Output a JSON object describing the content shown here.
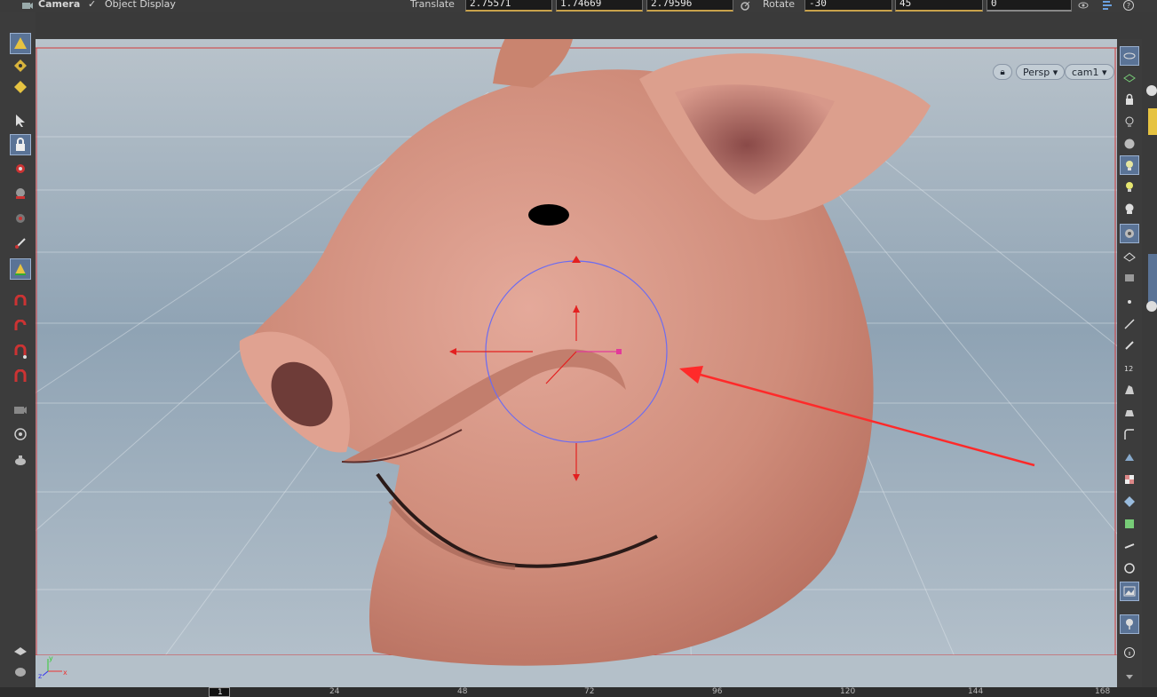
{
  "topbar": {
    "camera_label": "Camera",
    "object_display_label": "Object Display",
    "translate_label": "Translate",
    "translate_x": "2.75571",
    "translate_y": "1.74669",
    "translate_z": "2.79596",
    "rotate_label": "Rotate",
    "rotate_x": "-30",
    "rotate_y": "45",
    "rotate_z": "0"
  },
  "viewport": {
    "view_menu": "Persp",
    "camera_menu": "cam1",
    "axis_labels": {
      "x": "x",
      "y": "y",
      "z": "z"
    }
  },
  "timeline": {
    "current_frame": "1",
    "ticks": [
      "24",
      "48",
      "72",
      "96",
      "120",
      "144",
      "168"
    ]
  },
  "colors": {
    "accent_blue": "#5a7396",
    "handle_red": "#e32020",
    "annotation_arrow": "#ff2a2a",
    "ring": "#6d6cf0"
  },
  "icons": {
    "left_toolbar": [
      "pyramid-select-icon",
      "point-select-icon",
      "face-select-icon",
      "arrow-select-icon",
      "lock-icon",
      "pose-icon",
      "render-handle-icon",
      "light-handle-icon",
      "bone-icon",
      "translate-handle-icon",
      "magnet-move-icon",
      "magnet-curve-icon",
      "magnet-point-icon",
      "magnet-icon",
      "camera-icon",
      "camera-lens-icon",
      "teapot-icon",
      "display-icon",
      "shading-icon"
    ],
    "right_toolbar": [
      "view-options-icon",
      "layers-icon",
      "lock-icon",
      "light-bulb-icon",
      "sphere-icon",
      "headlight-icon",
      "light-icon",
      "skull-icon",
      "textured-view-icon",
      "wire-icon",
      "shading-mode-icon",
      "point-icon",
      "line-icon",
      "pen-icon",
      "number-icon",
      "paint-icon",
      "count-icon",
      "curve-icon",
      "brush-icon",
      "checker-icon",
      "diamond-icon",
      "box-icon",
      "bone-tool-icon",
      "circle-icon",
      "image-icon",
      "pin-icon",
      "info-icon",
      "chevron-down-icon"
    ]
  }
}
